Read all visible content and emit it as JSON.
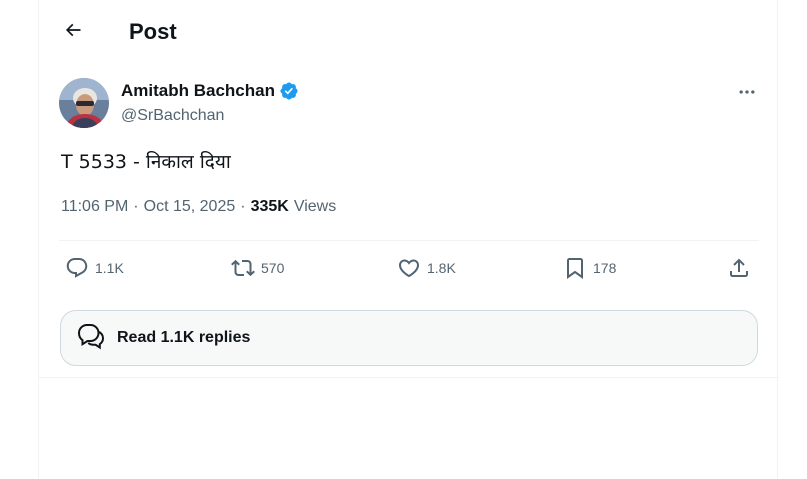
{
  "header": {
    "title": "Post",
    "back_icon": "arrow-left-icon"
  },
  "author": {
    "display_name": "Amitabh Bachchan",
    "handle": "@SrBachchan",
    "verified_icon": "verified-badge-icon",
    "verified_color": "#1d9bf0"
  },
  "post": {
    "text": "T 5533 - निकाल दिया",
    "time": "11:06 PM",
    "date": "Oct 15, 2025",
    "separator": "·",
    "views_count": "335K",
    "views_label": "Views"
  },
  "actions": {
    "replies": {
      "icon": "reply-bubble-icon",
      "count": "1.1K"
    },
    "reposts": {
      "icon": "repost-icon",
      "count": "570"
    },
    "likes": {
      "icon": "heart-icon",
      "count": "1.8K"
    },
    "bookmarks": {
      "icon": "bookmark-icon",
      "count": "178"
    },
    "share": {
      "icon": "share-upload-icon"
    }
  },
  "read_replies": {
    "label": "Read 1.1K replies",
    "icon": "reply-bubbles-icon"
  },
  "colors": {
    "text": "#0f1419",
    "secondary": "#536471",
    "border": "#eff3f4",
    "accent": "#1d9bf0"
  }
}
